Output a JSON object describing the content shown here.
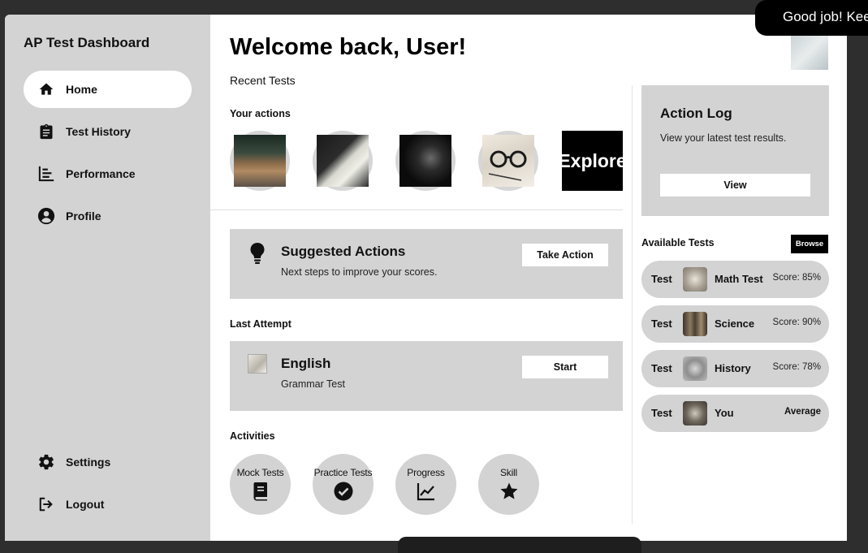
{
  "sidebar": {
    "title": "AP Test Dashboard",
    "nav": [
      {
        "label": "Home",
        "icon": "home-icon"
      },
      {
        "label": "Test History",
        "icon": "clipboard-icon"
      },
      {
        "label": "Performance",
        "icon": "bar-list-icon"
      },
      {
        "label": "Profile",
        "icon": "user-circle-icon"
      }
    ],
    "bottom_nav": [
      {
        "label": "Settings",
        "icon": "gear-icon"
      },
      {
        "label": "Logout",
        "icon": "logout-icon"
      }
    ]
  },
  "main": {
    "welcome": "Welcome back, User!",
    "recent_label": "Recent Tests",
    "your_actions_label": "Your actions",
    "explore_label": "Explore",
    "suggested": {
      "title": "Suggested Actions",
      "subtitle": "Next steps to improve your scores.",
      "button": "Take Action"
    },
    "last_attempt_label": "Last Attempt",
    "last_attempt": {
      "title": "English",
      "subtitle": "Grammar Test",
      "button": "Start"
    },
    "activities_label": "Activities",
    "activities": [
      {
        "label": "Mock Tests",
        "icon": "book-icon"
      },
      {
        "label": "Practice Tests",
        "icon": "check-circle-icon"
      },
      {
        "label": "Progress",
        "icon": "line-chart-icon"
      },
      {
        "label": "Skill",
        "icon": "star-icon"
      }
    ]
  },
  "right": {
    "action_log": {
      "title": "Action Log",
      "subtitle": "View your latest test results.",
      "button": "View"
    },
    "available_label": "Available Tests",
    "browse_label": "Browse",
    "tests": [
      {
        "prefix": "Test",
        "name": "Math Test",
        "score": "Score: 85%"
      },
      {
        "prefix": "Test",
        "name": "Science",
        "score": "Score: 90%"
      },
      {
        "prefix": "Test",
        "name": "History",
        "score": "Score: 78%"
      },
      {
        "prefix": "Test",
        "name": "You",
        "score": "Average"
      }
    ]
  },
  "toast": "Good job! Keep"
}
